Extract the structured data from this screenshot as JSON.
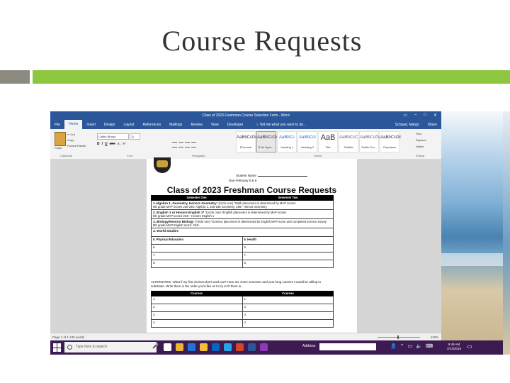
{
  "slide": {
    "title": "Course Requests"
  },
  "colors": {
    "bar_left": "#8c8a7e",
    "bar_right": "#8dc63f",
    "word_blue": "#2b579a",
    "taskbar": "#3d1a52"
  },
  "word": {
    "window_title": "Class of 2023 Freshman Course Selection Form - Word",
    "controls": [
      "▭",
      "–",
      "□",
      "✕"
    ],
    "tabs": [
      "File",
      "Home",
      "Insert",
      "Design",
      "Layout",
      "References",
      "Mailings",
      "Review",
      "View",
      "Developer"
    ],
    "tell_me": "♀ Tell me what you want to do...",
    "user": "Schaad, Margo",
    "share": "Share",
    "ribbon": {
      "paste": "Paste",
      "cut": "✂ Cut",
      "copy": "Copy",
      "format_painter": "Format Painter",
      "font": "Calibri (Body)",
      "font_size": "11",
      "format_buttons": [
        "B",
        "I",
        "U",
        "abc",
        "x₂",
        "x²"
      ],
      "groups": [
        "Clipboard",
        "Font",
        "Paragraph",
        "Styles",
        "Editing"
      ],
      "styles": [
        {
          "preview": "AaBbCcDc",
          "name": "¶ Normal"
        },
        {
          "preview": "AaBbCcDc",
          "name": "¶ No Spac..."
        },
        {
          "preview": "AaBbCc",
          "name": "Heading 1"
        },
        {
          "preview": "AaBbCcI",
          "name": "Heading 2"
        },
        {
          "preview": "AaB",
          "name": "Title"
        },
        {
          "preview": "AaBbCcC",
          "name": "Subtitle"
        },
        {
          "preview": "AaBbCcDc",
          "name": "Subtle Em..."
        },
        {
          "preview": "AaBbCcDc",
          "name": "Emphasis"
        }
      ],
      "find": "Find",
      "replace": "Replace",
      "select": "Select"
    },
    "document": {
      "student_name_label": "Student Name",
      "due": "Due February 5 & 6",
      "title": "Class of 2023 Freshman Course Requests",
      "headers": [
        "Semester One",
        "Semester Two"
      ],
      "rows": [
        {
          "bold": "1.Algebra 1, Geometry, Honors Geometry",
          "rest": " *(circle one) *Math placement is determined by MAP scores",
          "note": "8th grade MAP scores 238-245: Algebra 1, 246-255 Geometry, 256+ Honors Geometry"
        },
        {
          "bold": "2. English 1 or Honors English 1*",
          "rest": " *(circle one) *English placement is determined by MAP scores",
          "note": "8th grade MAP scores 234+: Honors English 1"
        },
        {
          "bold": "3. Biology/Honors Biology",
          "rest": " *(circle one) *Science placement is determined by English MAP score and completed science survey",
          "note": "8th grade MAP English score: 234+"
        },
        {
          "bold": "4. World Studies",
          "rest": "",
          "note": ""
        }
      ],
      "electives": [
        [
          "5. Physical Education",
          "5. Health"
        ],
        [
          "6.",
          "6."
        ],
        [
          "7.",
          "7."
        ],
        [
          "8.",
          "8."
        ]
      ],
      "alternates": "ALTERNATES: What if my first choices don't work out? Here are some semester and year-long courses I would be willing to substitute. Write them in the order you'd like us to try to fit them in.",
      "alt_headers": [
        "Courses",
        "Courses"
      ],
      "alt_rows": [
        [
          "1.",
          "1."
        ],
        [
          "2.",
          "2."
        ],
        [
          "3.",
          "3."
        ],
        [
          "4.",
          "4."
        ]
      ]
    },
    "status_left": "Page 1 of 1    240 words",
    "zoom": "110%"
  },
  "taskbar": {
    "search_placeholder": "Type here to search",
    "address_label": "Address",
    "time": "9:49 AM",
    "date": "2/13/2019",
    "apps": [
      {
        "name": "task-view",
        "color": "#ffffff"
      },
      {
        "name": "chrome",
        "color": "#e8b830"
      },
      {
        "name": "edge",
        "color": "#1f76d2"
      },
      {
        "name": "file-explorer",
        "color": "#f2c038"
      },
      {
        "name": "outlook",
        "color": "#0a64c2"
      },
      {
        "name": "photoshop",
        "color": "#27a3e6"
      },
      {
        "name": "powerpoint",
        "color": "#d24726"
      },
      {
        "name": "word",
        "color": "#2b579a"
      },
      {
        "name": "app-purple",
        "color": "#8a3ab9"
      }
    ]
  }
}
